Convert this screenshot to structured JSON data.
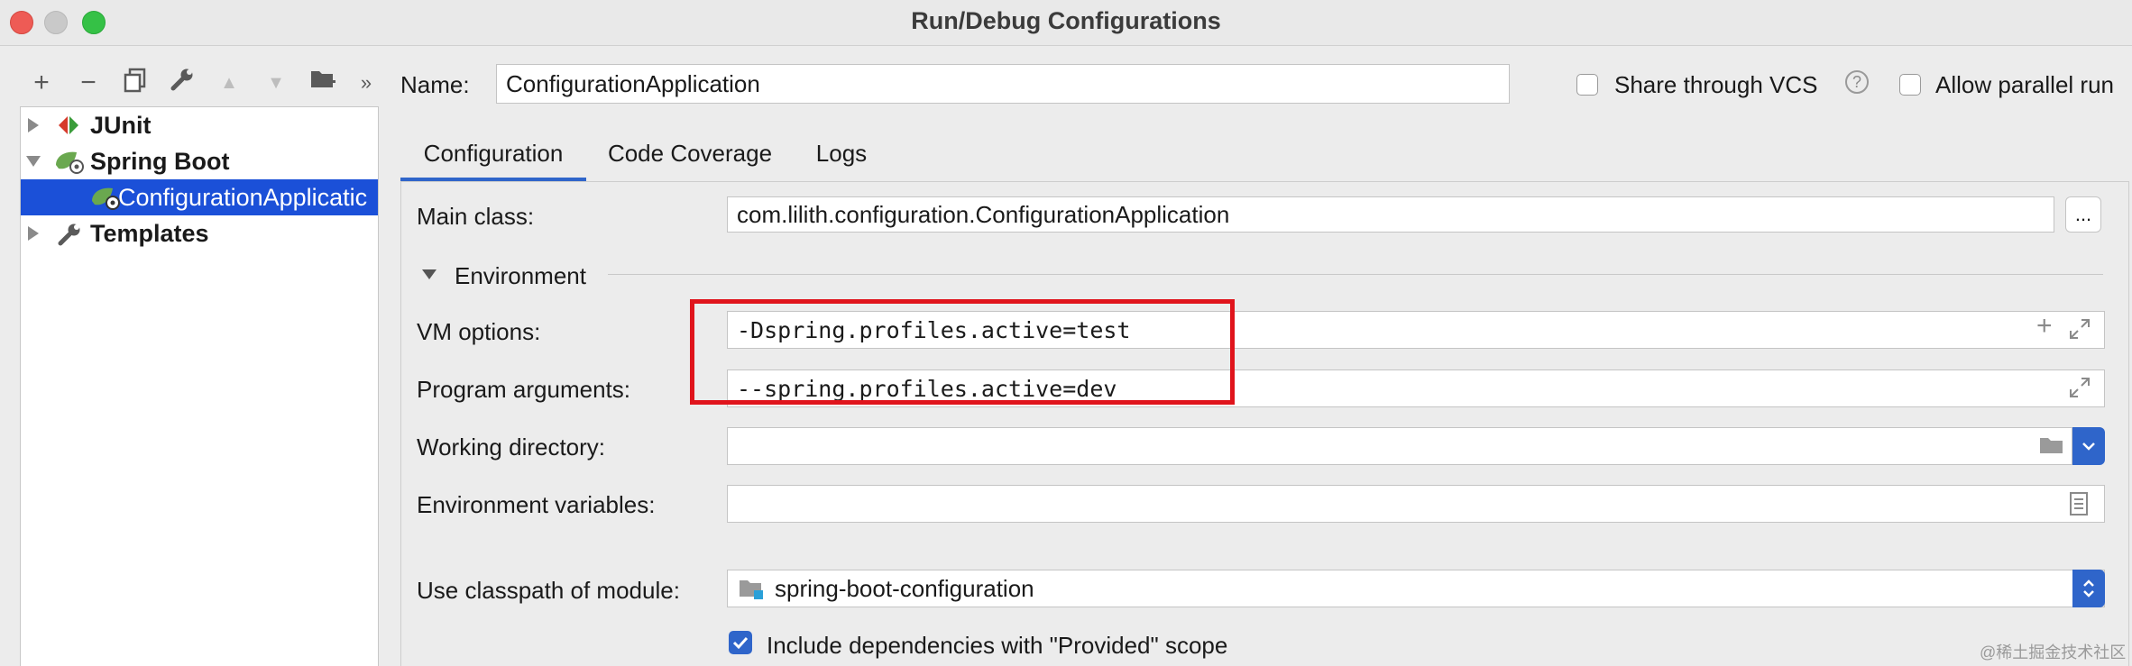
{
  "window": {
    "title": "Run/Debug Configurations"
  },
  "toolbar": {
    "add": "+",
    "remove": "−",
    "copy": "⧉",
    "edit": "🔧",
    "up": "▲",
    "down": "▼",
    "folder": "📁",
    "more": "»"
  },
  "tree": {
    "items": [
      {
        "label": "JUnit",
        "icon": "junit-icon"
      },
      {
        "label": "Spring Boot",
        "icon": "spring-boot-icon"
      },
      {
        "label": "ConfigurationApplicatic",
        "icon": "spring-boot-app-icon"
      },
      {
        "label": "Templates",
        "icon": "wrench-icon"
      }
    ]
  },
  "header": {
    "name_label": "Name:",
    "name_value": "ConfigurationApplication",
    "share_vcs_label": "Share through VCS",
    "help": "?",
    "allow_parallel_label": "Allow parallel run"
  },
  "tabs": [
    {
      "label": "Configuration",
      "active": true
    },
    {
      "label": "Code Coverage",
      "active": false
    },
    {
      "label": "Logs",
      "active": false
    }
  ],
  "form": {
    "main_class_label": "Main class:",
    "main_class_value": "com.lilith.configuration.ConfigurationApplication",
    "browse_button": "...",
    "environment_label": "Environment",
    "vm_options_label": "VM options:",
    "vm_options_value": "-Dspring.profiles.active=test",
    "program_args_label": "Program arguments:",
    "program_args_value": "--spring.profiles.active=dev",
    "working_dir_label": "Working directory:",
    "working_dir_value": "",
    "env_vars_label": "Environment variables:",
    "env_vars_value": "",
    "classpath_label": "Use classpath of module:",
    "classpath_value": "spring-boot-configuration",
    "include_deps_label": "Include dependencies with \"Provided\" scope",
    "include_deps_checked": true
  },
  "annotation": {
    "highlight_color": "#e0141c"
  },
  "watermark": "@稀土掘金技术社区",
  "colors": {
    "selection": "#1b50d8",
    "accent": "#2f65ca"
  }
}
